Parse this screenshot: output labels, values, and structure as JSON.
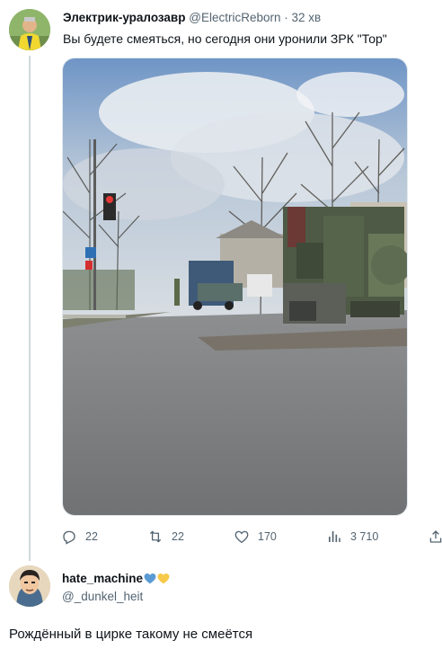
{
  "tweet": {
    "author_name": "Электрик-уралозавр",
    "author_handle": "@ElectricReborn",
    "separator": "·",
    "time": "32 хв",
    "text": "Вы будете смеяться, но сегодня они уронили ЗРК \"Тор\"",
    "media_icon": "photo-overturned-sam-vehicle"
  },
  "actions": {
    "reply_count": "22",
    "retweet_count": "22",
    "like_count": "170",
    "view_count": "3 710"
  },
  "reply": {
    "author_name": "hate_machine",
    "author_handle": "@_dunkel_heit",
    "text": "Рождённый в цирке такому не смеётся",
    "heart_colors": [
      "#5b9bd5",
      "#f7c948"
    ]
  },
  "colors": {
    "text_primary": "#0f1419",
    "text_secondary": "#536471",
    "thread_line": "#cfd9de"
  }
}
